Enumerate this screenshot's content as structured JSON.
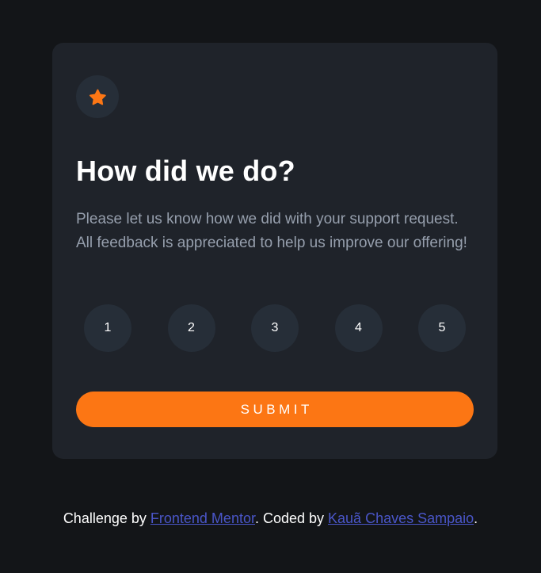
{
  "card": {
    "icon": "star-icon",
    "title": "How did we do?",
    "description": "Please let us know how we did with your support request. All feedback is appreciated to help us improve our offering!",
    "ratings": [
      "1",
      "2",
      "3",
      "4",
      "5"
    ],
    "submit_label": "SUBMIT"
  },
  "attribution": {
    "prefix": "Challenge by ",
    "mentor_link": "Frontend Mentor",
    "middle": ". Coded by ",
    "author_link": "Kauã Chaves Sampaio",
    "suffix": "."
  },
  "colors": {
    "background": "#131518",
    "card": "#1f232a",
    "circle": "#262e38",
    "accent": "#fc7614",
    "text_muted": "#969fad",
    "link": "#4a56c9"
  }
}
